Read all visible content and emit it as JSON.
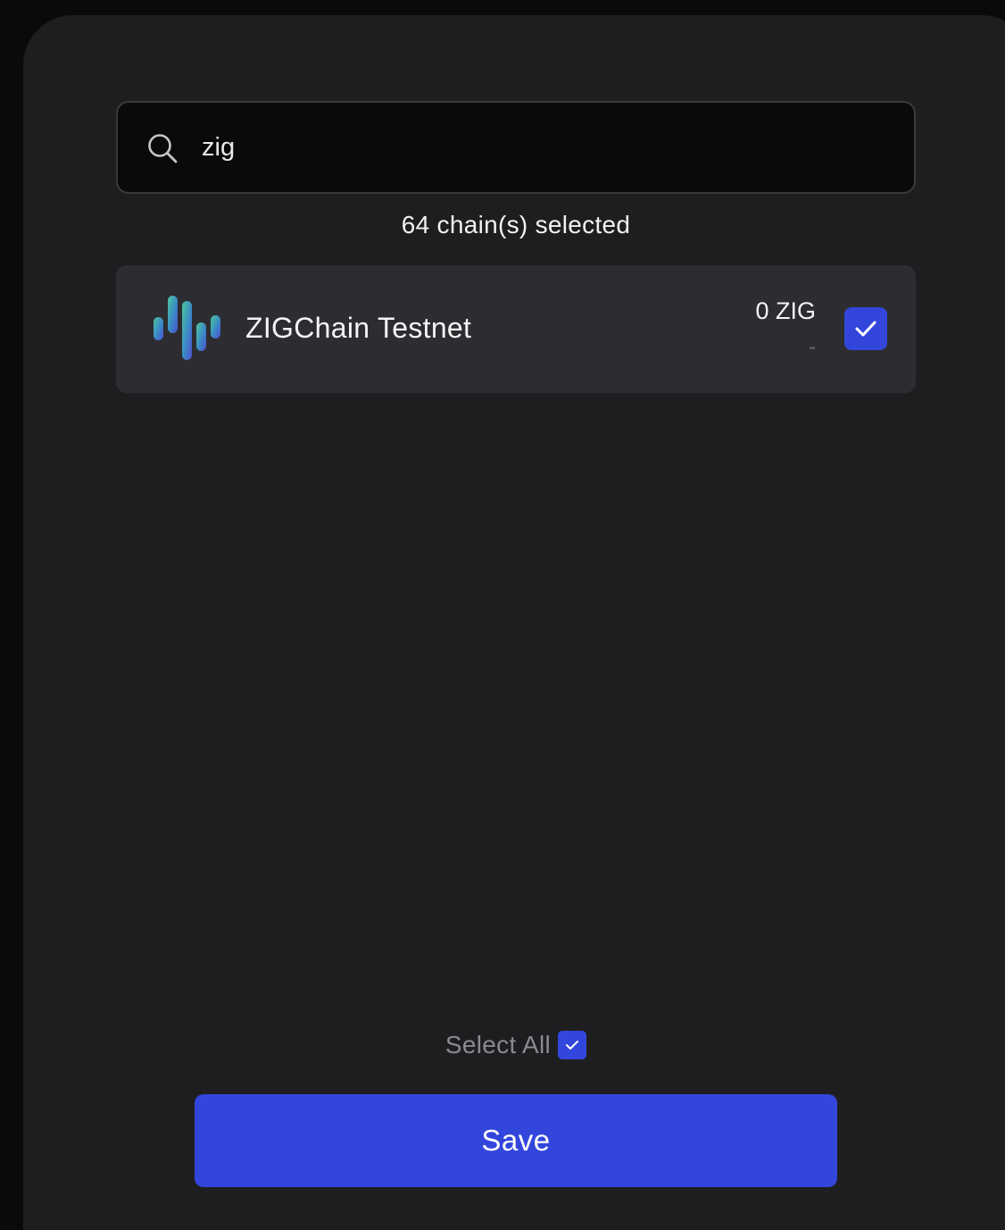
{
  "search": {
    "value": "zig",
    "icon": "search-icon"
  },
  "selection": {
    "count_text": "64 chain(s) selected"
  },
  "chains": [
    {
      "name": "ZIGChain Testnet",
      "balance": "0 ZIG",
      "fiat": "-",
      "checked": true,
      "logo": "zigchain-logo"
    }
  ],
  "select_all": {
    "label": "Select All",
    "checked": true
  },
  "save_button": {
    "label": "Save"
  },
  "colors": {
    "background": "#0a0a0b",
    "panel": "#1e1e20",
    "row": "#2d2d31",
    "accent": "#3346dc",
    "text": "#f4f4f5",
    "muted": "#8a8a8f"
  }
}
